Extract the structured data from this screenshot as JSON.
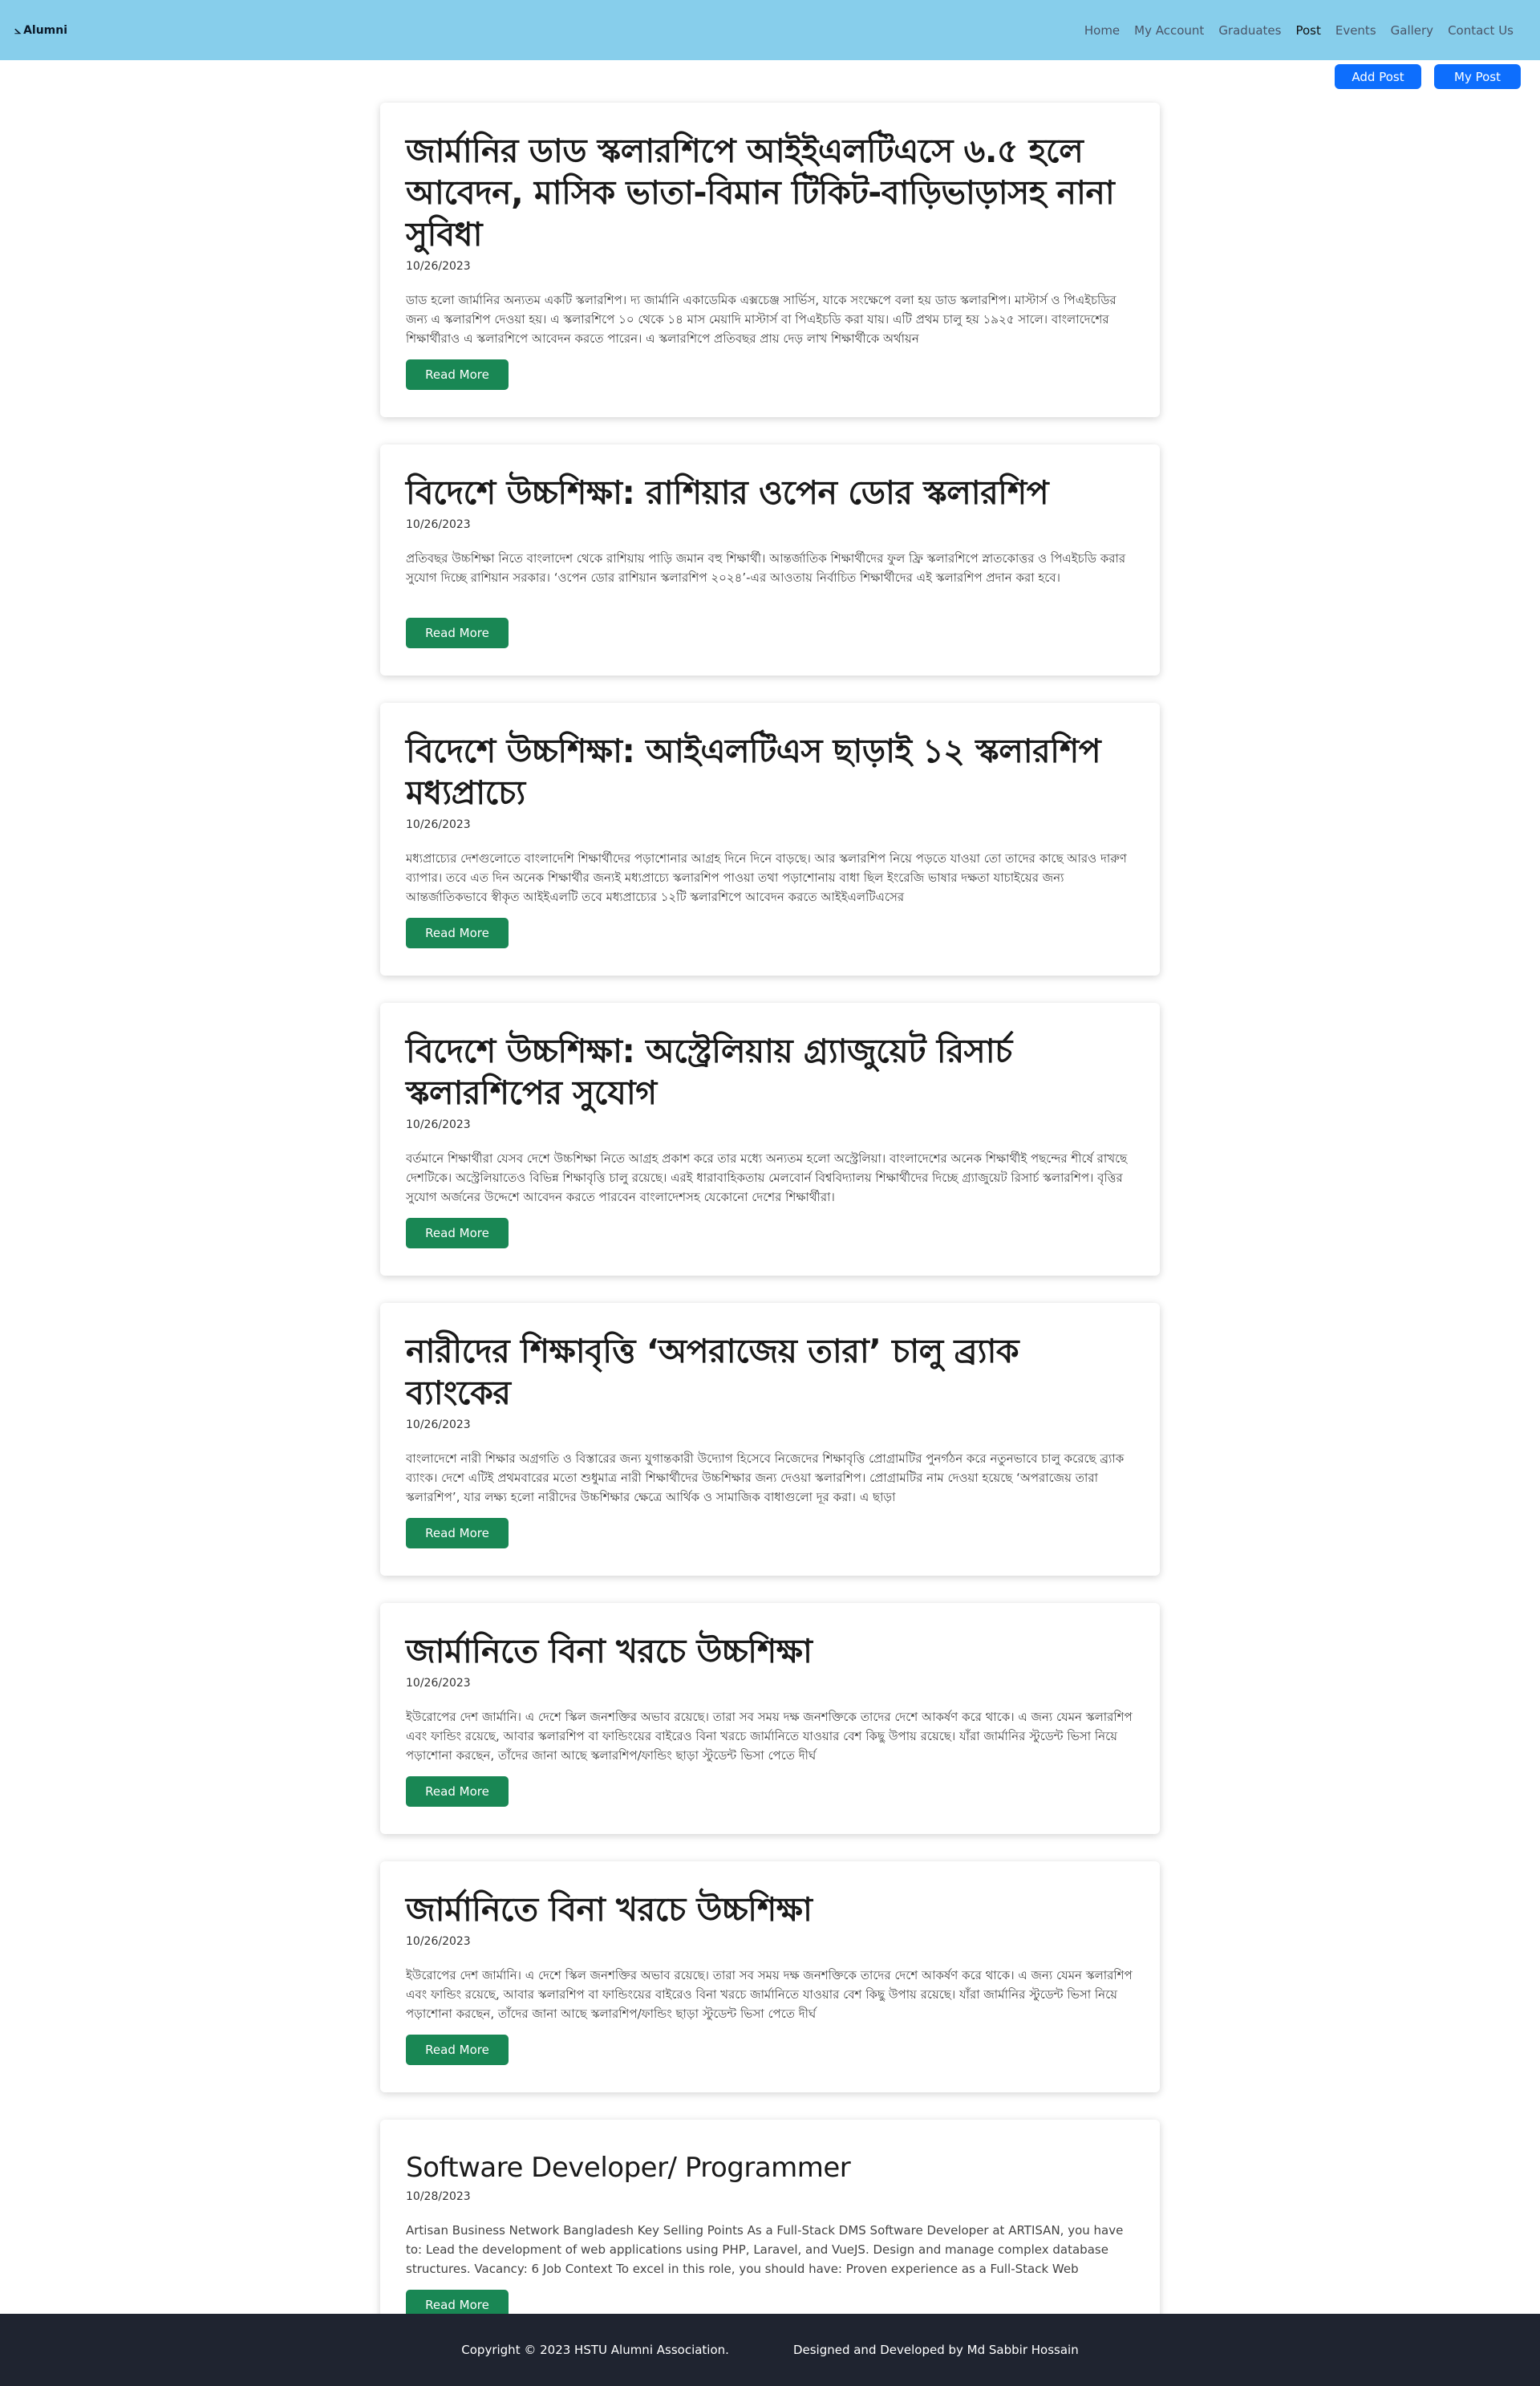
{
  "brand": {
    "name": "Alumni"
  },
  "nav": {
    "items": [
      {
        "label": "Home"
      },
      {
        "label": "My Account"
      },
      {
        "label": "Graduates"
      },
      {
        "label": "Post"
      },
      {
        "label": "Events"
      },
      {
        "label": "Gallery"
      },
      {
        "label": "Contact Us"
      }
    ]
  },
  "actions": {
    "add_post": "Add Post",
    "my_post": "My Post"
  },
  "posts": [
    {
      "title": "জার্মানির ডাড স্কলারশিপে আইইএলটিএসে ৬.৫ হলে আবেদন, মাসিক ভাতা-বিমান টিকিট-বাড়িভাড়াসহ নানা সুবিধা",
      "date": "10/26/2023",
      "excerpt": "ডাড হলো জার্মানির অন্যতম একটি স্কলারশিপ। দ্য জার্মানি একাডেমিক এক্সচেঞ্জ সার্ভিস, যাকে সংক্ষেপে বলা হয় ডাড স্কলারশিপ। মাস্টার্স ও পিএইচডির জন্য এ স্কলারশিপ দেওয়া হয়। এ স্কলারশিপে ১০ থেকে ১৪ মাস মেয়াদি মাস্টার্স বা পিএইচডি করা যায়। এটি প্রথম চালু হয় ১৯২৫ সালে। বাংলাদেশের শিক্ষার্থীরাও এ স্কলারশিপে আবেদন করতে পারেন। এ স্কলারশিপে প্রতিবছর প্রায় দেড় লাখ শিক্ষার্থীকে অর্থায়ন",
      "read_more": "Read More"
    },
    {
      "title": "বিদেশে উচ্চশিক্ষা: রাশিয়ার ওপেন ডোর স্কলারশিপ",
      "date": "10/26/2023",
      "excerpt": "প্রতিবছর উচ্চশিক্ষা নিতে বাংলাদেশ থেকে রাশিয়ায় পাড়ি জমান বহু শিক্ষার্থী। আন্তর্জাতিক শিক্ষার্থীদের ফুল ফ্রি স্কলারশিপে স্নাতকোত্তর ও পিএইচডি করার সুযোগ দিচ্ছে রাশিয়ান সরকার। ‘ওপেন ডোর রাশিয়ান স্কলারশিপ ২০২৪’-এর আওতায় নির্বাচিত শিক্ষার্থীদের এই স্কলারশিপ প্রদান করা হবে।",
      "read_more": "Read More"
    },
    {
      "title": "বিদেশে উচ্চশিক্ষা: আইএলটিএস ছাড়াই ১২ স্কলারশিপ মধ্যপ্রাচ্যে",
      "date": "10/26/2023",
      "excerpt": "মধ্যপ্রাচ্যের দেশগুলোতে বাংলাদেশি শিক্ষার্থীদের পড়াশোনার আগ্রহ দিনে দিনে বাড়ছে। আর স্কলারশিপ নিয়ে পড়তে যাওয়া তো তাদের কাছে আরও দারুণ ব্যাপার। তবে এত দিন অনেক শিক্ষার্থীর জন্যই মধ্যপ্রাচ্যে স্কলারশিপ পাওয়া তথা পড়াশোনায় বাধা ছিল ইংরেজি ভাষার দক্ষতা যাচাইয়ের জন্য আন্তর্জাতিকভাবে স্বীকৃত আইইএলটি তবে মধ্যপ্রাচ্যের ১২টি স্কলারশিপে আবেদন করতে আইইএলটিএসের",
      "read_more": "Read More"
    },
    {
      "title": "বিদেশে উচ্চশিক্ষা: অস্ট্রেলিয়ায় গ্র্যাজুয়েট রিসার্চ স্কলারশিপের সুযোগ",
      "date": "10/26/2023",
      "excerpt": "বর্তমানে শিক্ষার্থীরা যেসব দেশে উচ্চশিক্ষা নিতে আগ্রহ প্রকাশ করে তার মধ্যে অন্যতম হলো অস্ট্রেলিয়া। বাংলাদেশের অনেক শিক্ষার্থীই পছন্দের শীর্ষে রাখছে দেশটিকে। অস্ট্রেলিয়াতেও বিভিন্ন শিক্ষাবৃত্তি চালু রয়েছে। এরই ধারাবাহিকতায় মেলবোর্ন বিশ্ববিদ্যালয় শিক্ষার্থীদের দিচ্ছে গ্র্যাজুয়েট রিসার্চ স্কলারশিপ। বৃত্তির সুযোগ অর্জনের উদ্দেশে আবেদন করতে পারবেন বাংলাদেশসহ যেকোনো দেশের শিক্ষার্থীরা।",
      "read_more": "Read More"
    },
    {
      "title": "নারীদের শিক্ষাবৃত্তি ‘অপরাজেয় তারা’ চালু ব্র্যাক ব্যাংকের",
      "date": "10/26/2023",
      "excerpt": "বাংলাদেশে নারী শিক্ষার অগ্রগতি ও বিস্তারের জন্য যুগান্তকারী উদ্যোগ হিসেবে নিজেদের শিক্ষাবৃত্তি প্রোগ্রামটির পুনর্গঠন করে নতুনভাবে চালু করেছে ব্র্যাক ব্যাংক। দেশে এটিই প্রথমবারের মতো শুধুমাত্র নারী শিক্ষার্থীদের উচ্চশিক্ষার জন্য দেওয়া স্কলারশিপ। প্রোগ্রামটির নাম দেওয়া হয়েছে ‘অপরাজেয় তারা স্কলারশিপ’, যার লক্ষ্য হলো নারীদের উচ্চশিক্ষার ক্ষেত্রে আর্থিক ও সামাজিক বাধাগুলো দূর করা। এ ছাড়া",
      "read_more": "Read More"
    },
    {
      "title": "জার্মানিতে বিনা খরচে উচ্চশিক্ষা",
      "date": "10/26/2023",
      "excerpt": "ইউরোপের দেশ জার্মানি। এ দেশে স্কিল জনশক্তির অভাব রয়েছে। তারা সব সময় দক্ষ জনশক্তিকে তাদের দেশে আকর্ষণ করে থাকে। এ জন্য যেমন স্কলারশিপ এবং ফান্ডিং রয়েছে, আবার স্কলারশিপ বা ফান্ডিংয়ের বাইরেও বিনা খরচে জার্মানিতে যাওয়ার বেশ কিছু উপায় রয়েছে। যাঁরা জার্মানির স্টুডেন্ট ভিসা নিয়ে পড়াশোনা করছেন, তাঁদের জানা আছে স্কলারশিপ/ফান্ডিং ছাড়া স্টুডেন্ট ভিসা পেতে দীর্ঘ",
      "read_more": "Read More"
    },
    {
      "title": "জার্মানিতে বিনা খরচে উচ্চশিক্ষা",
      "date": "10/26/2023",
      "excerpt": "ইউরোপের দেশ জার্মানি। এ দেশে স্কিল জনশক্তির অভাব রয়েছে। তারা সব সময় দক্ষ জনশক্তিকে তাদের দেশে আকর্ষণ করে থাকে। এ জন্য যেমন স্কলারশিপ এবং ফান্ডিং রয়েছে, আবার স্কলারশিপ বা ফান্ডিংয়ের বাইরেও বিনা খরচে জার্মানিতে যাওয়ার বেশ কিছু উপায় রয়েছে। যাঁরা জার্মানির স্টুডেন্ট ভিসা নিয়ে পড়াশোনা করছেন, তাঁদের জানা আছে স্কলারশিপ/ফান্ডিং ছাড়া স্টুডেন্ট ভিসা পেতে দীর্ঘ",
      "read_more": "Read More"
    },
    {
      "title": "Software Developer/ Programmer",
      "date": "10/28/2023",
      "excerpt": "Artisan Business Network Bangladesh Key Selling Points As a Full-Stack DMS Software Developer at ARTISAN, you have to: Lead the development of web applications using PHP, Laravel, and VueJS. Design and manage complex database structures. Vacancy: 6 Job Context To excel in this role, you should have: Proven experience as a Full-Stack Web Developer with expertise in PHP,",
      "read_more": "Read More"
    }
  ],
  "footer": {
    "copyright": "Copyright © 2023 HSTU Alumni Association.",
    "credit": "Designed and Developed by Md Sabbir Hossain"
  }
}
